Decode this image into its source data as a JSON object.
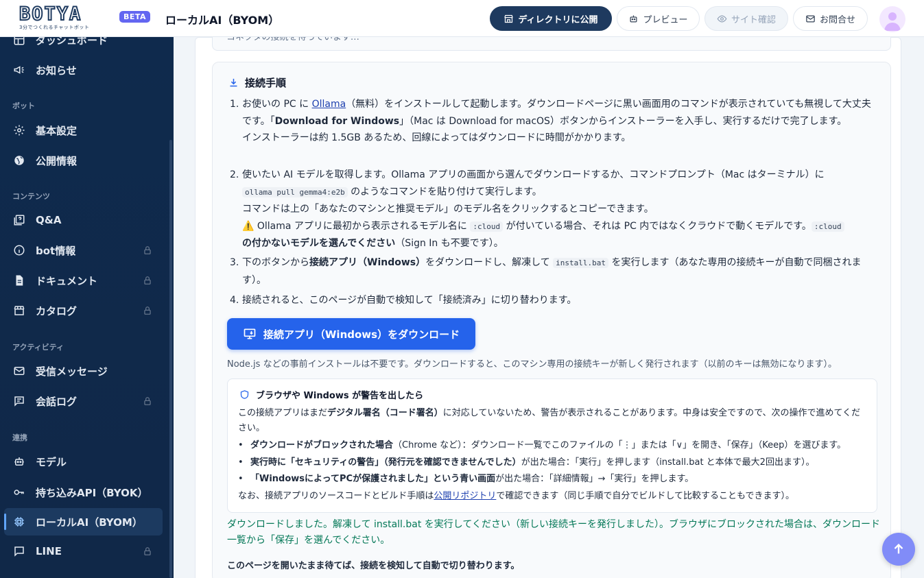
{
  "header": {
    "logo_text": "BOTYA",
    "logo_sub": "3分でつくれるチャットボット",
    "beta": "BETA",
    "title": "ローカルAI（BYOM）",
    "buttons": {
      "publish": "ディレクトリに公開",
      "preview": "プレビュー",
      "site_check": "サイト確認",
      "contact": "お問合せ"
    }
  },
  "sidebar": {
    "items": {
      "dashboard": "ダッシュボード",
      "news": "お知らせ",
      "basic": "基本設定",
      "public_info": "公開情報",
      "qa": "Q&A",
      "bot_info": "bot情報",
      "document": "ドキュメント",
      "catalog": "カタログ",
      "messages": "受信メッセージ",
      "chat_log": "会話ログ",
      "model": "モデル",
      "byok": "持ち込みAPI（BYOK）",
      "local_ai": "ローカルAI（BYOM）",
      "line": "LINE"
    },
    "sections": {
      "bot": "ボット",
      "content": "コンテンツ",
      "activity": "アクティビティ",
      "link": "連携"
    }
  },
  "main": {
    "prev_status": "コネクタの接続を待っています…",
    "steps_title": "接続手順",
    "step1": {
      "num": "1.",
      "a": "お使いの PC に ",
      "link": "Ollama",
      "b": "（無料）をインストールして起動します。ダウンロードページに黒い画面用のコマンドが表示されていても無視して大丈夫です。「",
      "bold": "Download for Windows",
      "c": "」（Mac は Download for macOS）ボタンからインストーラーを入手し、実行するだけで完了します。",
      "d": "インストーラーは約 1.5GB あるため、回線によってはダウンロードに時間がかかります。"
    },
    "step2": {
      "num": "2.",
      "a": "使いたい AI モデルを取得します。Ollama アプリの画面から選んでダウンロードするか、コマンドプロンプト（Mac はターミナル）に",
      "code": "ollama pull gemma4:e2b",
      "b": " のようなコマンドを貼り付けて実行します。",
      "c": "コマンドは上の「あなたのマシンと推奨モデル」のモデル名をクリックするとコピーできます。",
      "warn_icon": "⚠️",
      "d": " Ollama アプリに最初から表示されるモデル名に ",
      "code2": ":cloud",
      "e": " が付いている場合、それは PC 内ではなくクラウドで動くモデルです。",
      "code3": ":cloud",
      "bold": "の付かないモデルを選んでください",
      "f": "（Sign In も不要です）。"
    },
    "step3": {
      "num": "3.",
      "a": "下のボタンから",
      "bold": "接続アプリ（Windows）",
      "b": "をダウンロードし、解凍して ",
      "code": "install.bat",
      "c": " を実行します（あなた専用の接続キーが自動で同梱されます）。"
    },
    "step4": {
      "num": "4.",
      "a": "接続されると、このページが自動で検知して「接続済み」に切り替わります。"
    },
    "download_button": "接続アプリ（Windows）をダウンロード",
    "note": "Node.js などの事前インストールは不要です。ダウンロードすると、このマシン専用の接続キーが新しく発行されます（以前のキーは無効になります）。",
    "warn": {
      "title": "ブラウザや Windows が警告を出したら",
      "intro_a": "この接続アプリはまだ",
      "intro_bold": "デジタル署名（コード署名）",
      "intro_b": "に対応していないため、警告が表示されることがあります。中身は安全ですので、次の操作で進めてください。",
      "li1_bold": "ダウンロードがブロックされた場合",
      "li1": "（Chrome など）：ダウンロード一覧でこのファイルの「⋮」または「∨」を開き、「保存」（Keep）を選びます。",
      "li2_bold": "実行時に「セキュリティの警告」（発行元を確認できませんでした）",
      "li2": "が出た場合：「実行」を押します（install.bat と本体で最大2回出ます）。",
      "li3_bold": "「WindowsによってPCが保護されました」という青い画面",
      "li3": "が出た場合：「詳細情報」→「実行」を押します。",
      "foot_a": "なお、接続アプリのソースコードとビルド手順は",
      "foot_link": "公開リポジトリ",
      "foot_b": "で確認できます（同じ手順で自分でビルドして比較することもできます）。"
    },
    "success": "ダウンロードしました。解凍して install.bat を実行してください（新しい接続キーを発行しました）。ブラウザにブロックされた場合は、ダウンロード一覧から「保存」を選んでください。",
    "wait": "このページを開いたまま待てば、接続を検知して自動で切り替わります。"
  },
  "colors": {
    "primary": "#2563eb",
    "navy": "#1e3a5f",
    "sidebar": "#0f2a4d",
    "success": "#047857",
    "beta": "#6366f1"
  }
}
